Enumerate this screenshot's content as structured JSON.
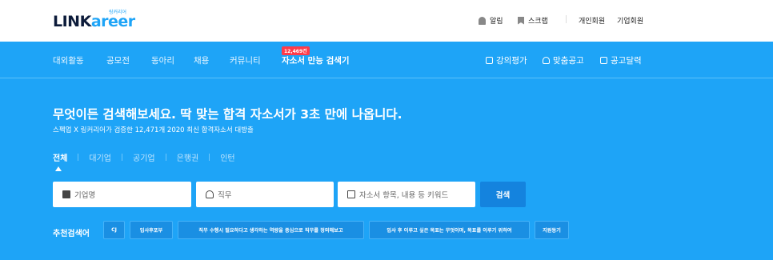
{
  "header": {
    "logo_sub": "링커리어",
    "logo_main_a": "LINK",
    "logo_main_b": "areer",
    "alarm_label": "알림",
    "scrap_label": "스크랩",
    "personal_member": "개인회원",
    "corporate_member": "기업회원"
  },
  "nav": {
    "items": [
      "대외활동",
      "공모전",
      "동아리",
      "채용",
      "커뮤니티",
      "자소서 만능 검색기"
    ],
    "badge": "12,469건",
    "right": [
      "강의평가",
      "맞춤공고",
      "공고달력"
    ]
  },
  "hero": {
    "title": "무엇이든 검색해보세요. 딱 맞는 합격 자소서가 3초 만에 나옵니다.",
    "subtitle": "스펙업 X 링커리어가 검증한 12,471개 2020 최신 합격자소서 대방출"
  },
  "tabs": [
    "전체",
    "대기업",
    "공기업",
    "은행권",
    "인턴"
  ],
  "search": {
    "company_placeholder": "기업명",
    "job_placeholder": "직무",
    "keyword_placeholder": "자소서 항목, 내용 등 키워드",
    "button": "검색"
  },
  "recommended": {
    "label": "추천검색어",
    "chips": [
      "CJ",
      "입사후포부",
      "직무 수행시 필요하다고 생각하는 역량을 중심으로 직무를 정의해보고",
      "입사 후 이루고 싶은 목표는 무엇이며, 목표를 이루기 위하여",
      "지원동기"
    ]
  },
  "colors": {
    "primary": "#1ea4f7",
    "button": "#1483de",
    "badge": "#ff3b4a"
  }
}
